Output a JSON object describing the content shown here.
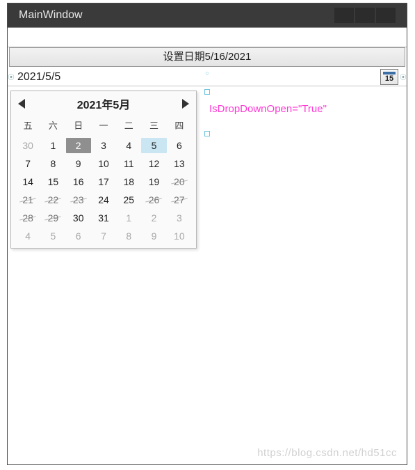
{
  "window": {
    "title": "MainWindow"
  },
  "button": {
    "label": "设置日期5/16/2021"
  },
  "datepicker": {
    "value": "2021/5/5",
    "icon_day": "15"
  },
  "annotation": "IsDropDownOpen=\"True\"",
  "calendar": {
    "title": "2021年5月",
    "dow": [
      "五",
      "六",
      "日",
      "一",
      "二",
      "三",
      "四"
    ],
    "days": [
      {
        "n": "30",
        "other": true
      },
      {
        "n": "1"
      },
      {
        "n": "2",
        "selected": true
      },
      {
        "n": "3"
      },
      {
        "n": "4"
      },
      {
        "n": "5",
        "today": true
      },
      {
        "n": "6"
      },
      {
        "n": "7"
      },
      {
        "n": "8"
      },
      {
        "n": "9"
      },
      {
        "n": "10"
      },
      {
        "n": "11"
      },
      {
        "n": "12"
      },
      {
        "n": "13"
      },
      {
        "n": "14"
      },
      {
        "n": "15"
      },
      {
        "n": "16"
      },
      {
        "n": "17"
      },
      {
        "n": "18"
      },
      {
        "n": "19"
      },
      {
        "n": "20",
        "blackout": true
      },
      {
        "n": "21",
        "blackout": true
      },
      {
        "n": "22",
        "blackout": true
      },
      {
        "n": "23",
        "blackout": true
      },
      {
        "n": "24"
      },
      {
        "n": "25"
      },
      {
        "n": "26",
        "blackout": true
      },
      {
        "n": "27",
        "blackout": true
      },
      {
        "n": "28",
        "blackout": true
      },
      {
        "n": "29",
        "blackout": true
      },
      {
        "n": "30"
      },
      {
        "n": "31"
      },
      {
        "n": "1",
        "other": true
      },
      {
        "n": "2",
        "other": true
      },
      {
        "n": "3",
        "other": true
      },
      {
        "n": "4",
        "other": true
      },
      {
        "n": "5",
        "other": true
      },
      {
        "n": "6",
        "other": true
      },
      {
        "n": "7",
        "other": true
      },
      {
        "n": "8",
        "other": true
      },
      {
        "n": "9",
        "other": true
      },
      {
        "n": "10",
        "other": true
      }
    ]
  },
  "watermark": "https://blog.csdn.net/hd51cc"
}
